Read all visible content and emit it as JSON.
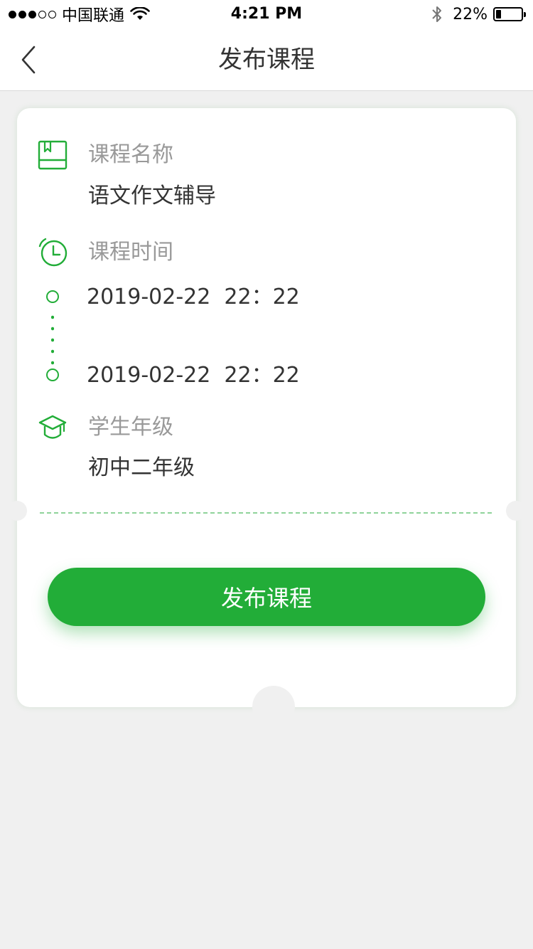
{
  "status_bar": {
    "carrier": "中国联通",
    "time": "4:21 PM",
    "battery_percent": "22%",
    "battery_level": 0.22,
    "signal_bars_filled": 3,
    "signal_bars_total": 5
  },
  "nav": {
    "title": "发布课程",
    "back_icon": "chevron-left-icon"
  },
  "course": {
    "name_label": "课程名称",
    "name_value": "语文作文辅导",
    "time_label": "课程时间",
    "start_time": "2019-02-22  22：22",
    "end_time": "2019-02-22  22：22",
    "grade_label": "学生年级",
    "grade_value": "初中二年级"
  },
  "actions": {
    "publish_label": "发布课程"
  },
  "colors": {
    "accent": "#22ad38",
    "label": "#999999",
    "text": "#333333",
    "background": "#f0f0f0"
  }
}
